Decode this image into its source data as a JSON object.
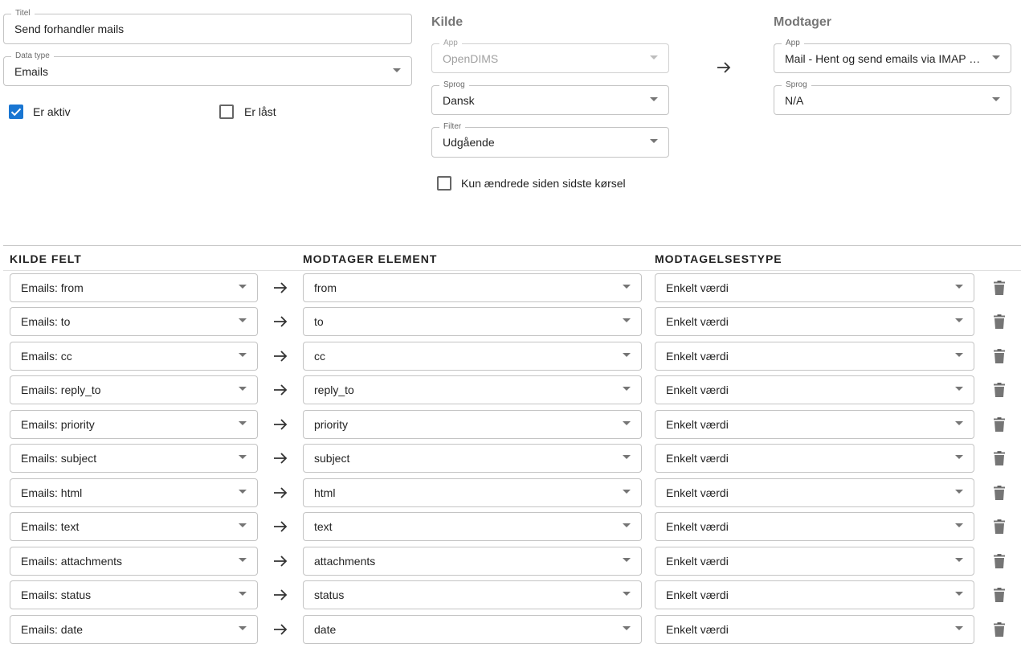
{
  "form": {
    "title": {
      "label": "Titel",
      "value": "Send forhandler mails"
    },
    "data_type": {
      "label": "Data type",
      "value": "Emails"
    },
    "is_active": {
      "label": "Er aktiv",
      "checked": true
    },
    "is_locked": {
      "label": "Er låst",
      "checked": false
    }
  },
  "source": {
    "heading": "Kilde",
    "app": {
      "label": "App",
      "value": "OpenDIMS",
      "disabled": true
    },
    "language": {
      "label": "Sprog",
      "value": "Dansk"
    },
    "filter": {
      "label": "Filter",
      "value": "Udgående"
    },
    "only_changed": {
      "label": "Kun ændrede siden sidste kørsel",
      "checked": false
    }
  },
  "receiver": {
    "heading": "Modtager",
    "app": {
      "label": "App",
      "value": "Mail - Hent og send emails via IMAP og SMTP"
    },
    "language": {
      "label": "Sprog",
      "value": "N/A"
    }
  },
  "mapping": {
    "columns": {
      "source_field": "KILDE FELT",
      "receiver_element": "MODTAGER ELEMENT",
      "receive_type": "MODTAGELSESTYPE"
    },
    "rows": [
      {
        "source": "Emails: from",
        "target": "from",
        "type": "Enkelt værdi"
      },
      {
        "source": "Emails: to",
        "target": "to",
        "type": "Enkelt værdi"
      },
      {
        "source": "Emails: cc",
        "target": "cc",
        "type": "Enkelt værdi"
      },
      {
        "source": "Emails: reply_to",
        "target": "reply_to",
        "type": "Enkelt værdi"
      },
      {
        "source": "Emails: priority",
        "target": "priority",
        "type": "Enkelt værdi"
      },
      {
        "source": "Emails: subject",
        "target": "subject",
        "type": "Enkelt værdi"
      },
      {
        "source": "Emails: html",
        "target": "html",
        "type": "Enkelt værdi"
      },
      {
        "source": "Emails: text",
        "target": "text",
        "type": "Enkelt værdi"
      },
      {
        "source": "Emails: attachments",
        "target": "attachments",
        "type": "Enkelt værdi"
      },
      {
        "source": "Emails: status",
        "target": "status",
        "type": "Enkelt værdi"
      },
      {
        "source": "Emails: date",
        "target": "date",
        "type": "Enkelt værdi"
      }
    ]
  },
  "icons": {
    "arrow": "arrow-right-icon",
    "delete": "trash-icon",
    "caret": "chevron-down-icon",
    "check": "check-icon"
  },
  "colors": {
    "accent": "#1976d2"
  }
}
